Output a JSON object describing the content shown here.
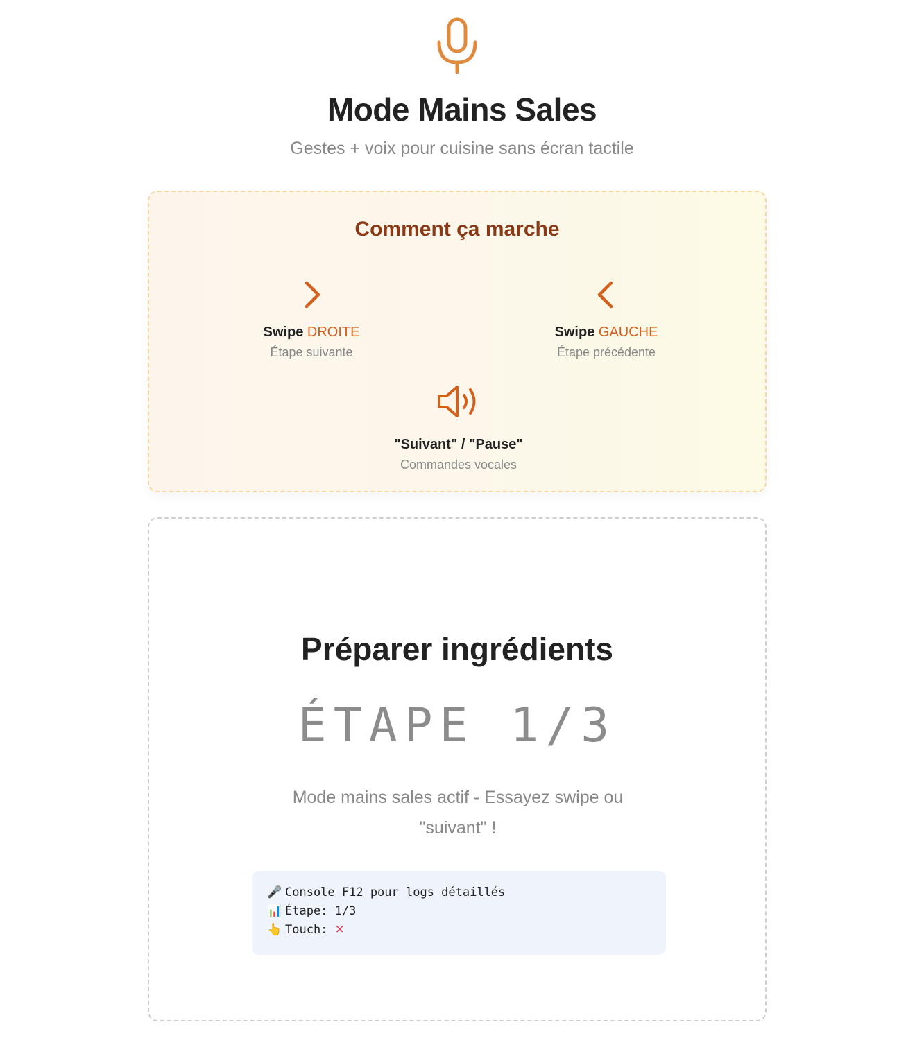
{
  "header": {
    "icon": "microphone-icon",
    "title": "Mode Mains Sales",
    "subtitle": "Gestes + voix pour cuisine sans écran tactile"
  },
  "how_it_works": {
    "title": "Comment ça marche",
    "gestures": [
      {
        "icon": "chevron-right-icon",
        "label_prefix": "Swipe",
        "label_accent": "DROITE",
        "desc": "Étape suivante"
      },
      {
        "icon": "chevron-left-icon",
        "label_prefix": "Swipe",
        "label_accent": "GAUCHE",
        "desc": "Étape précédente"
      }
    ],
    "voice": {
      "icon": "speaker-icon",
      "label": "\"Suivant\" / \"Pause\"",
      "desc": "Commandes vocales"
    }
  },
  "step": {
    "title": "Préparer ingrédients",
    "counter": "ÉTAPE 1/3",
    "message": "Mode mains sales actif - Essayez swipe ou \"suivant\" !"
  },
  "console": {
    "lines": [
      {
        "emoji": "🎤",
        "text": "Console F12 pour logs détaillés"
      },
      {
        "emoji": "📊",
        "text": "Étape: 1/3"
      },
      {
        "emoji": "👆",
        "text": "Touch: ",
        "status": "✕"
      }
    ]
  },
  "colors": {
    "accent": "#d2601e",
    "how_title": "#8a3a17",
    "muted": "#888888"
  }
}
